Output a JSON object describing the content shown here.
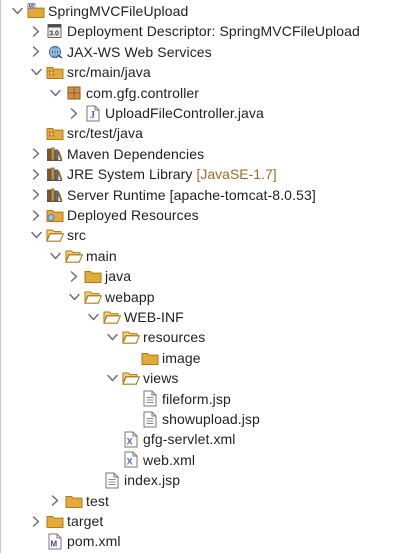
{
  "tree": [
    {
      "id": "project-springmvcfileupload",
      "label": "SpringMVCFileUpload",
      "icon": "project-icon",
      "chevron": "down",
      "depth": 0
    },
    {
      "id": "deployment-descriptor",
      "label": "Deployment Descriptor: SpringMVCFileUpload",
      "icon": "deployment-descriptor-icon",
      "chevron": "right",
      "depth": 1
    },
    {
      "id": "jax-ws-web-services",
      "label": "JAX-WS Web Services",
      "icon": "web-services-icon",
      "chevron": "right",
      "depth": 1
    },
    {
      "id": "src-main-java",
      "label": "src/main/java",
      "icon": "source-folder-icon",
      "chevron": "down",
      "depth": 1
    },
    {
      "id": "com-gfg-controller",
      "label": "com.gfg.controller",
      "icon": "package-icon",
      "chevron": "down",
      "depth": 2
    },
    {
      "id": "uploadfilecontroller-java",
      "label": "UploadFileController.java",
      "icon": "java-file-icon",
      "chevron": "right",
      "depth": 3
    },
    {
      "id": "src-test-java",
      "label": "src/test/java",
      "icon": "source-folder-icon",
      "chevron": "none",
      "depth": 1
    },
    {
      "id": "maven-dependencies",
      "label": "Maven Dependencies",
      "icon": "library-icon",
      "chevron": "right",
      "depth": 1
    },
    {
      "id": "jre-system-library",
      "label": "JRE System Library",
      "decoration": "[JavaSE-1.7]",
      "icon": "library-icon",
      "chevron": "right",
      "depth": 1
    },
    {
      "id": "server-runtime",
      "label": "Server Runtime [apache-tomcat-8.0.53]",
      "icon": "library-icon",
      "chevron": "right",
      "depth": 1
    },
    {
      "id": "deployed-resources",
      "label": "Deployed Resources",
      "icon": "deployed-resources-icon",
      "chevron": "right",
      "depth": 1
    },
    {
      "id": "src",
      "label": "src",
      "icon": "folder-open-icon",
      "chevron": "down",
      "depth": 1
    },
    {
      "id": "main",
      "label": "main",
      "icon": "folder-open-icon",
      "chevron": "down",
      "depth": 2
    },
    {
      "id": "java",
      "label": "java",
      "icon": "folder-icon",
      "chevron": "right",
      "depth": 3
    },
    {
      "id": "webapp",
      "label": "webapp",
      "icon": "folder-open-icon",
      "chevron": "down",
      "depth": 3
    },
    {
      "id": "web-inf",
      "label": "WEB-INF",
      "icon": "folder-open-icon",
      "chevron": "down",
      "depth": 4
    },
    {
      "id": "resources",
      "label": "resources",
      "icon": "folder-open-icon",
      "chevron": "down",
      "depth": 5
    },
    {
      "id": "image",
      "label": "image",
      "icon": "folder-icon",
      "chevron": "none",
      "depth": 6
    },
    {
      "id": "views",
      "label": "views",
      "icon": "folder-open-icon",
      "chevron": "down",
      "depth": 5
    },
    {
      "id": "fileform-jsp",
      "label": "fileform.jsp",
      "icon": "file-icon",
      "chevron": "none",
      "depth": 6
    },
    {
      "id": "showupload-jsp",
      "label": "showupload.jsp",
      "icon": "file-icon",
      "chevron": "none",
      "depth": 6
    },
    {
      "id": "gfg-servlet-xml",
      "label": "gfg-servlet.xml",
      "icon": "xml-file-icon",
      "chevron": "none",
      "depth": 5
    },
    {
      "id": "web-xml",
      "label": "web.xml",
      "icon": "xml-file-icon",
      "chevron": "none",
      "depth": 5
    },
    {
      "id": "index-jsp",
      "label": "index.jsp",
      "icon": "file-icon",
      "chevron": "none",
      "depth": 4
    },
    {
      "id": "test",
      "label": "test",
      "icon": "folder-icon",
      "chevron": "right",
      "depth": 2
    },
    {
      "id": "target",
      "label": "target",
      "icon": "folder-icon",
      "chevron": "right",
      "depth": 1
    },
    {
      "id": "pom-xml",
      "label": "pom.xml",
      "icon": "maven-pom-icon",
      "chevron": "none",
      "depth": 1
    }
  ],
  "colors": {
    "folder": "#e2a93b",
    "folder_stroke": "#b07a17",
    "decoration": "#9a6d2b",
    "chevron": "#6b6b6b",
    "java_blue": "#3c6bb3",
    "package_brown": "#b5712c"
  }
}
